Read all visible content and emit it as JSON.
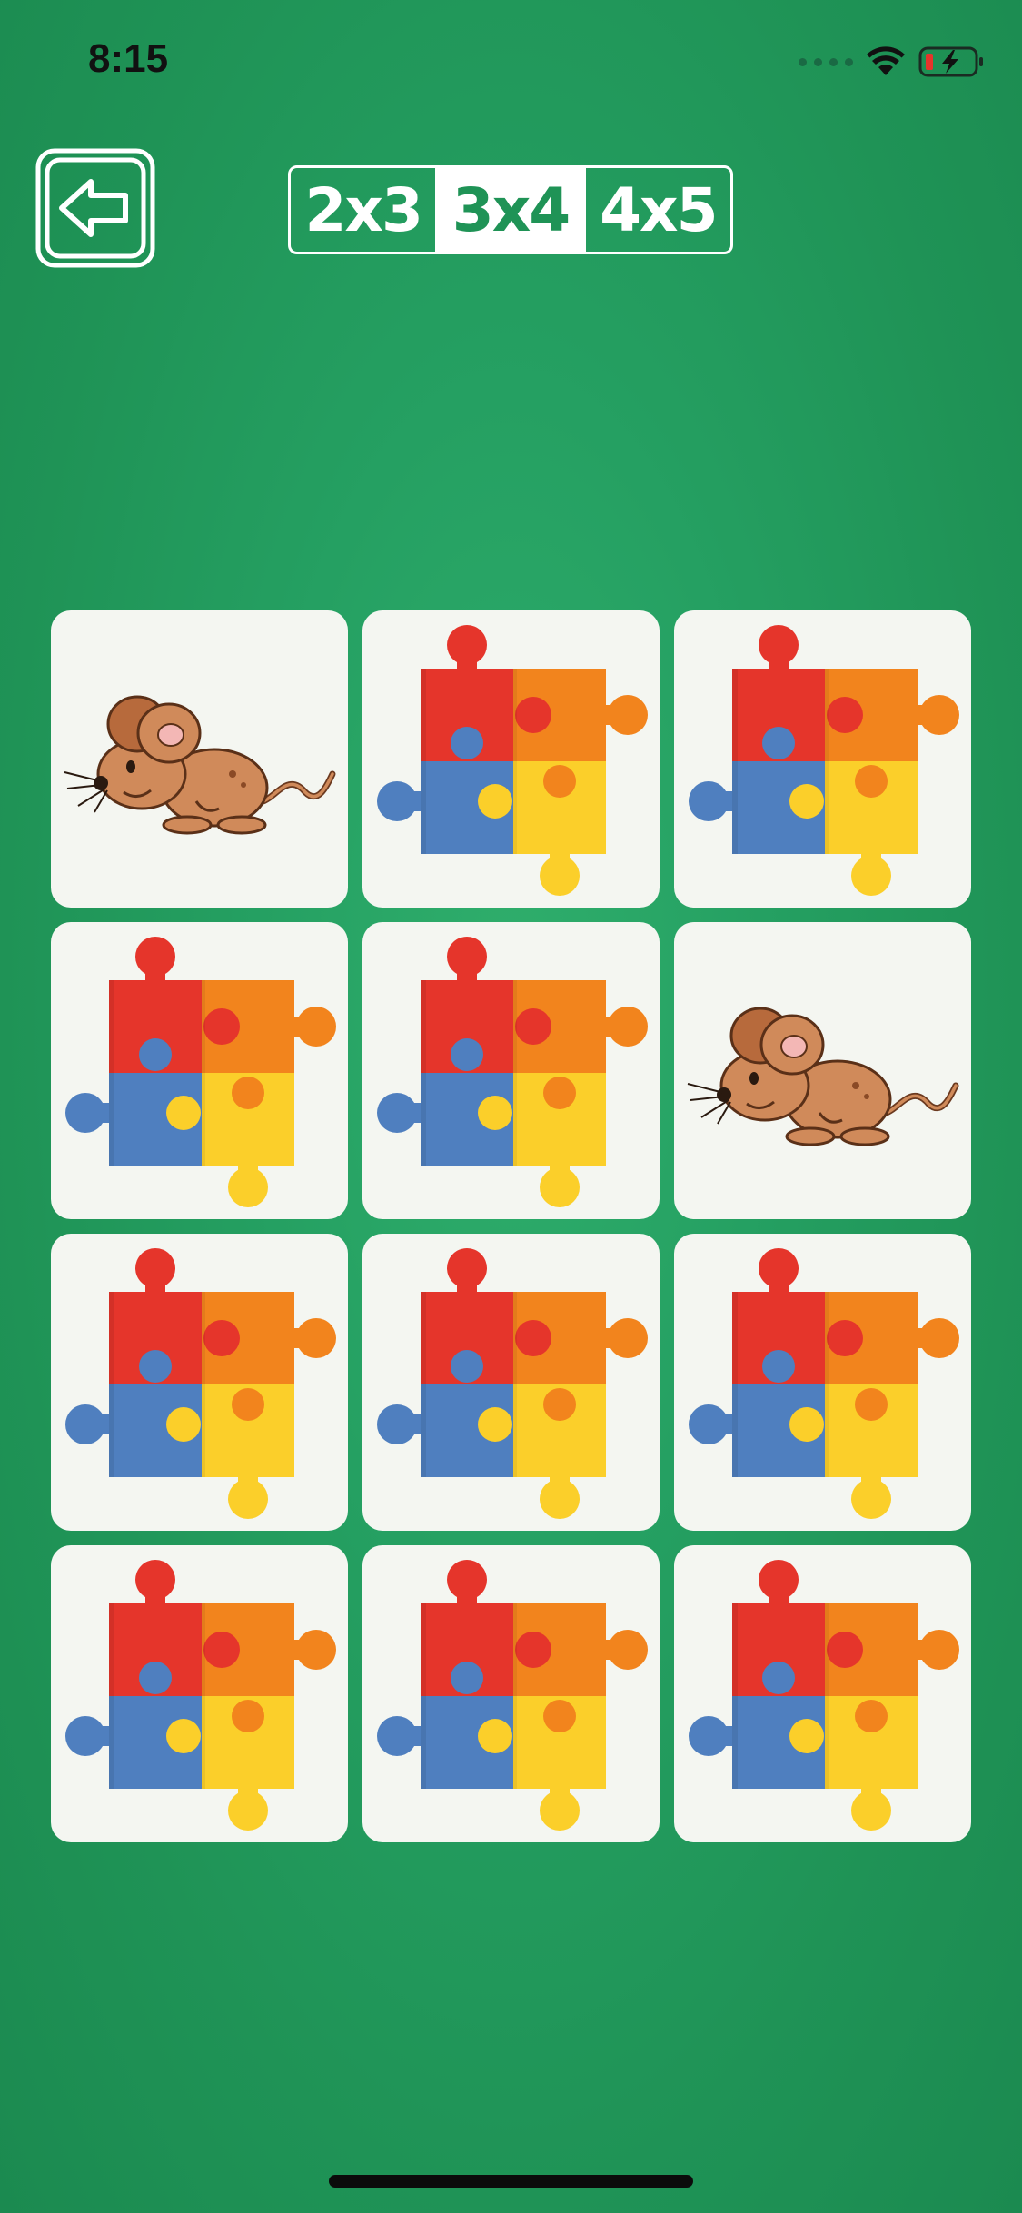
{
  "status_bar": {
    "time": "8:15"
  },
  "back_button": {
    "icon": "back-arrow-icon"
  },
  "grid_size_selector": {
    "options": [
      "2x3",
      "3x4",
      "4x5"
    ],
    "selected": "3x4"
  },
  "board": {
    "rows": 4,
    "columns": 3,
    "cards": [
      {
        "state": "face-up",
        "image": "mouse"
      },
      {
        "state": "face-down",
        "image": "puzzle-pieces"
      },
      {
        "state": "face-down",
        "image": "puzzle-pieces"
      },
      {
        "state": "face-down",
        "image": "puzzle-pieces"
      },
      {
        "state": "face-down",
        "image": "puzzle-pieces"
      },
      {
        "state": "face-up",
        "image": "mouse"
      },
      {
        "state": "face-down",
        "image": "puzzle-pieces"
      },
      {
        "state": "face-down",
        "image": "puzzle-pieces"
      },
      {
        "state": "face-down",
        "image": "puzzle-pieces"
      },
      {
        "state": "face-down",
        "image": "puzzle-pieces"
      },
      {
        "state": "face-down",
        "image": "puzzle-pieces"
      },
      {
        "state": "face-down",
        "image": "puzzle-pieces"
      }
    ]
  },
  "colors": {
    "background": "#1f9356",
    "card": "#f4f6f1",
    "puzzle_red": "#e5352b",
    "puzzle_orange": "#f2841d",
    "puzzle_blue": "#4f7fbf",
    "puzzle_yellow": "#fbcf2a",
    "mouse_body": "#d08a5a"
  }
}
